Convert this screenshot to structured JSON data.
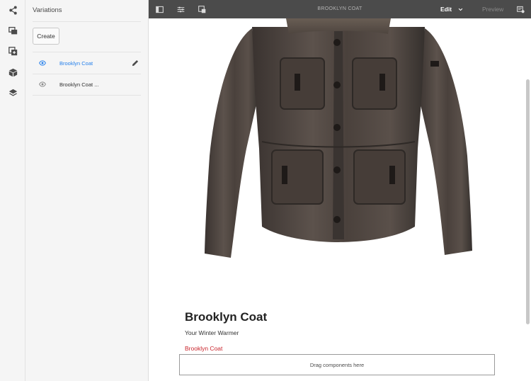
{
  "rail": {
    "items": [
      {
        "icon": "share-icon",
        "label": ""
      },
      {
        "icon": "assets-icon",
        "label": ""
      },
      {
        "icon": "add-component-icon",
        "label": ""
      },
      {
        "icon": "cube-icon",
        "label": ""
      },
      {
        "icon": "layers-icon",
        "label": ""
      }
    ]
  },
  "panel": {
    "title": "Variations",
    "create_label": "Create",
    "variations": [
      {
        "label": "Brooklyn Coat",
        "active": true
      },
      {
        "label": "Brooklyn Coat ...",
        "active": false
      }
    ]
  },
  "toolbar": {
    "title": "BROOKLYN COAT",
    "mode": "Edit",
    "preview_label": "Preview",
    "icons": [
      "side-panel-icon",
      "properties-icon",
      "emulator-icon",
      "annotations-icon"
    ]
  },
  "content": {
    "product_title": "Brooklyn Coat",
    "product_subtitle": "Your Winter Warmer",
    "product_link": "Brooklyn Coat",
    "dropzone_text": "Drag components here"
  },
  "colors": {
    "accent_blue": "#2680eb",
    "link_red": "#c9252c",
    "toolbar_bg": "#4b4b4b",
    "panel_bg": "#f5f5f5"
  }
}
